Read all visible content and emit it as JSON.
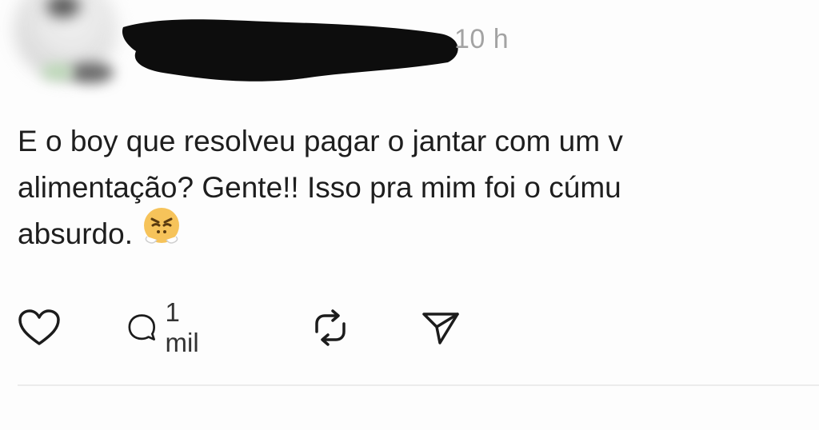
{
  "post": {
    "timestamp": "10 h",
    "text_lines": [
      "E o boy que resolveu pagar o jantar com um v",
      "alimentação? Gente!! Isso pra mim foi o cúmu",
      "absurdo."
    ],
    "emoji": "face-with-steam-from-nose-icon"
  },
  "actions": {
    "like_icon": "heart-icon",
    "reply_icon": "comment-bubble-icon",
    "reply_count": "1 mil",
    "repost_icon": "repost-icon",
    "share_icon": "send-icon"
  },
  "colors": {
    "text": "#1e1e1e",
    "muted": "#a3a3a3",
    "divider": "#ececec",
    "emoji_face": "#f6c35a"
  }
}
